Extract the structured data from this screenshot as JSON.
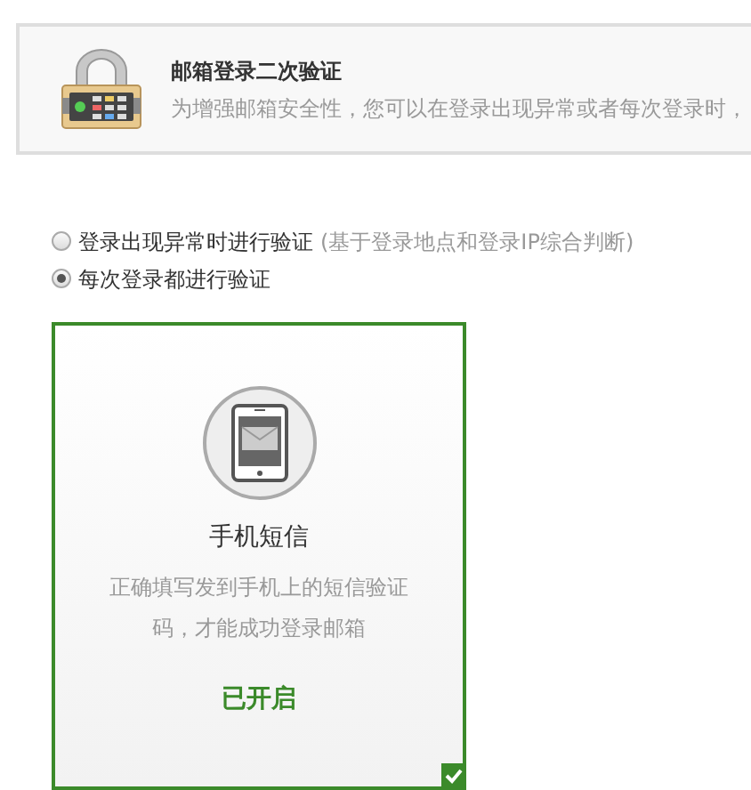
{
  "header": {
    "title": "邮箱登录二次验证",
    "description": "为增强邮箱安全性，您可以在登录出现异常或者每次登录时，"
  },
  "options": [
    {
      "label": "登录出现异常时进行验证",
      "note": "(基于登录地点和登录IP综合判断)",
      "selected": false
    },
    {
      "label": "每次登录都进行验证",
      "selected": true
    }
  ],
  "methods": [
    {
      "title": "手机短信",
      "description": "正确填写发到手机上的短信验证码，才能成功登录邮箱",
      "status": "已开启",
      "selected": true
    }
  ]
}
